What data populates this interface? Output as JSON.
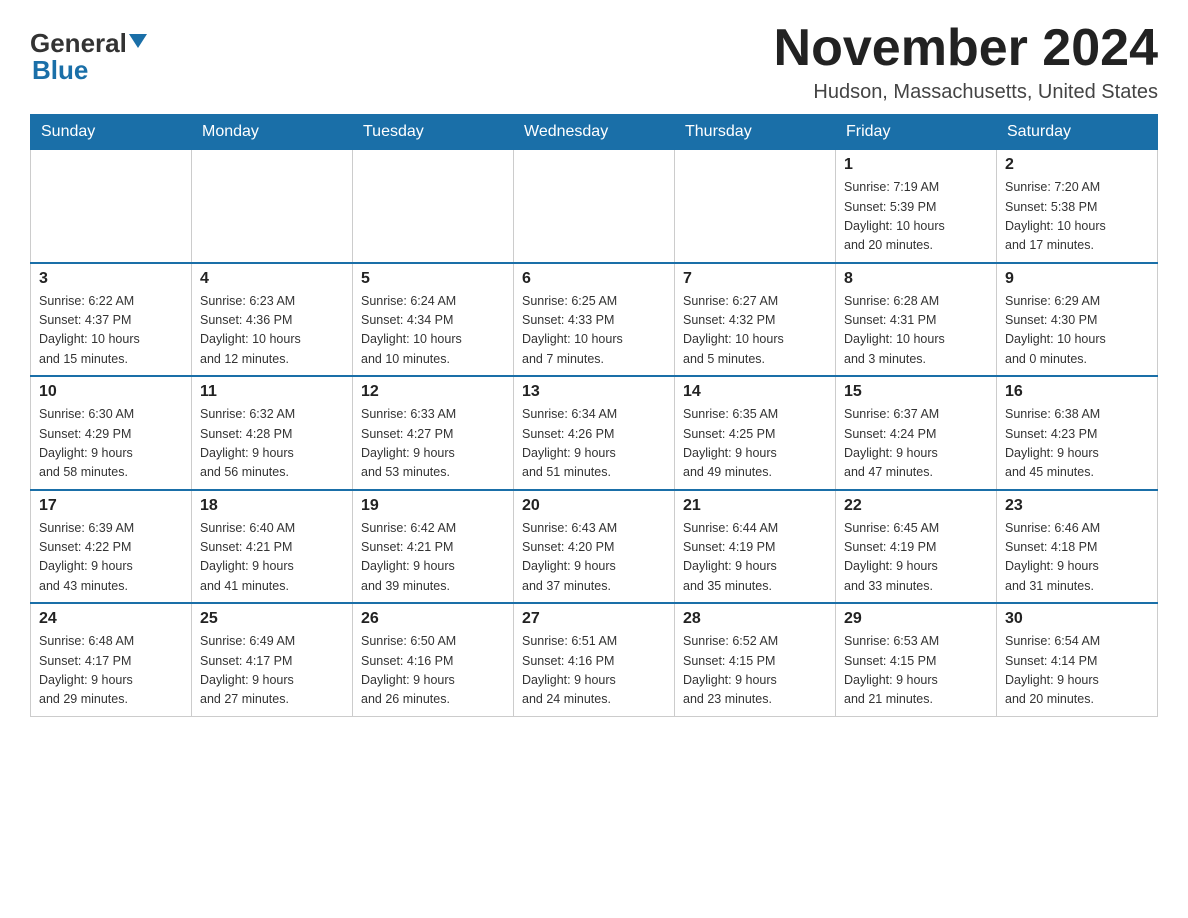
{
  "header": {
    "logo_general": "General",
    "logo_blue": "Blue",
    "month_title": "November 2024",
    "location": "Hudson, Massachusetts, United States"
  },
  "weekdays": [
    "Sunday",
    "Monday",
    "Tuesday",
    "Wednesday",
    "Thursday",
    "Friday",
    "Saturday"
  ],
  "weeks": [
    [
      {
        "day": "",
        "info": ""
      },
      {
        "day": "",
        "info": ""
      },
      {
        "day": "",
        "info": ""
      },
      {
        "day": "",
        "info": ""
      },
      {
        "day": "",
        "info": ""
      },
      {
        "day": "1",
        "info": "Sunrise: 7:19 AM\nSunset: 5:39 PM\nDaylight: 10 hours\nand 20 minutes."
      },
      {
        "day": "2",
        "info": "Sunrise: 7:20 AM\nSunset: 5:38 PM\nDaylight: 10 hours\nand 17 minutes."
      }
    ],
    [
      {
        "day": "3",
        "info": "Sunrise: 6:22 AM\nSunset: 4:37 PM\nDaylight: 10 hours\nand 15 minutes."
      },
      {
        "day": "4",
        "info": "Sunrise: 6:23 AM\nSunset: 4:36 PM\nDaylight: 10 hours\nand 12 minutes."
      },
      {
        "day": "5",
        "info": "Sunrise: 6:24 AM\nSunset: 4:34 PM\nDaylight: 10 hours\nand 10 minutes."
      },
      {
        "day": "6",
        "info": "Sunrise: 6:25 AM\nSunset: 4:33 PM\nDaylight: 10 hours\nand 7 minutes."
      },
      {
        "day": "7",
        "info": "Sunrise: 6:27 AM\nSunset: 4:32 PM\nDaylight: 10 hours\nand 5 minutes."
      },
      {
        "day": "8",
        "info": "Sunrise: 6:28 AM\nSunset: 4:31 PM\nDaylight: 10 hours\nand 3 minutes."
      },
      {
        "day": "9",
        "info": "Sunrise: 6:29 AM\nSunset: 4:30 PM\nDaylight: 10 hours\nand 0 minutes."
      }
    ],
    [
      {
        "day": "10",
        "info": "Sunrise: 6:30 AM\nSunset: 4:29 PM\nDaylight: 9 hours\nand 58 minutes."
      },
      {
        "day": "11",
        "info": "Sunrise: 6:32 AM\nSunset: 4:28 PM\nDaylight: 9 hours\nand 56 minutes."
      },
      {
        "day": "12",
        "info": "Sunrise: 6:33 AM\nSunset: 4:27 PM\nDaylight: 9 hours\nand 53 minutes."
      },
      {
        "day": "13",
        "info": "Sunrise: 6:34 AM\nSunset: 4:26 PM\nDaylight: 9 hours\nand 51 minutes."
      },
      {
        "day": "14",
        "info": "Sunrise: 6:35 AM\nSunset: 4:25 PM\nDaylight: 9 hours\nand 49 minutes."
      },
      {
        "day": "15",
        "info": "Sunrise: 6:37 AM\nSunset: 4:24 PM\nDaylight: 9 hours\nand 47 minutes."
      },
      {
        "day": "16",
        "info": "Sunrise: 6:38 AM\nSunset: 4:23 PM\nDaylight: 9 hours\nand 45 minutes."
      }
    ],
    [
      {
        "day": "17",
        "info": "Sunrise: 6:39 AM\nSunset: 4:22 PM\nDaylight: 9 hours\nand 43 minutes."
      },
      {
        "day": "18",
        "info": "Sunrise: 6:40 AM\nSunset: 4:21 PM\nDaylight: 9 hours\nand 41 minutes."
      },
      {
        "day": "19",
        "info": "Sunrise: 6:42 AM\nSunset: 4:21 PM\nDaylight: 9 hours\nand 39 minutes."
      },
      {
        "day": "20",
        "info": "Sunrise: 6:43 AM\nSunset: 4:20 PM\nDaylight: 9 hours\nand 37 minutes."
      },
      {
        "day": "21",
        "info": "Sunrise: 6:44 AM\nSunset: 4:19 PM\nDaylight: 9 hours\nand 35 minutes."
      },
      {
        "day": "22",
        "info": "Sunrise: 6:45 AM\nSunset: 4:19 PM\nDaylight: 9 hours\nand 33 minutes."
      },
      {
        "day": "23",
        "info": "Sunrise: 6:46 AM\nSunset: 4:18 PM\nDaylight: 9 hours\nand 31 minutes."
      }
    ],
    [
      {
        "day": "24",
        "info": "Sunrise: 6:48 AM\nSunset: 4:17 PM\nDaylight: 9 hours\nand 29 minutes."
      },
      {
        "day": "25",
        "info": "Sunrise: 6:49 AM\nSunset: 4:17 PM\nDaylight: 9 hours\nand 27 minutes."
      },
      {
        "day": "26",
        "info": "Sunrise: 6:50 AM\nSunset: 4:16 PM\nDaylight: 9 hours\nand 26 minutes."
      },
      {
        "day": "27",
        "info": "Sunrise: 6:51 AM\nSunset: 4:16 PM\nDaylight: 9 hours\nand 24 minutes."
      },
      {
        "day": "28",
        "info": "Sunrise: 6:52 AM\nSunset: 4:15 PM\nDaylight: 9 hours\nand 23 minutes."
      },
      {
        "day": "29",
        "info": "Sunrise: 6:53 AM\nSunset: 4:15 PM\nDaylight: 9 hours\nand 21 minutes."
      },
      {
        "day": "30",
        "info": "Sunrise: 6:54 AM\nSunset: 4:14 PM\nDaylight: 9 hours\nand 20 minutes."
      }
    ]
  ]
}
